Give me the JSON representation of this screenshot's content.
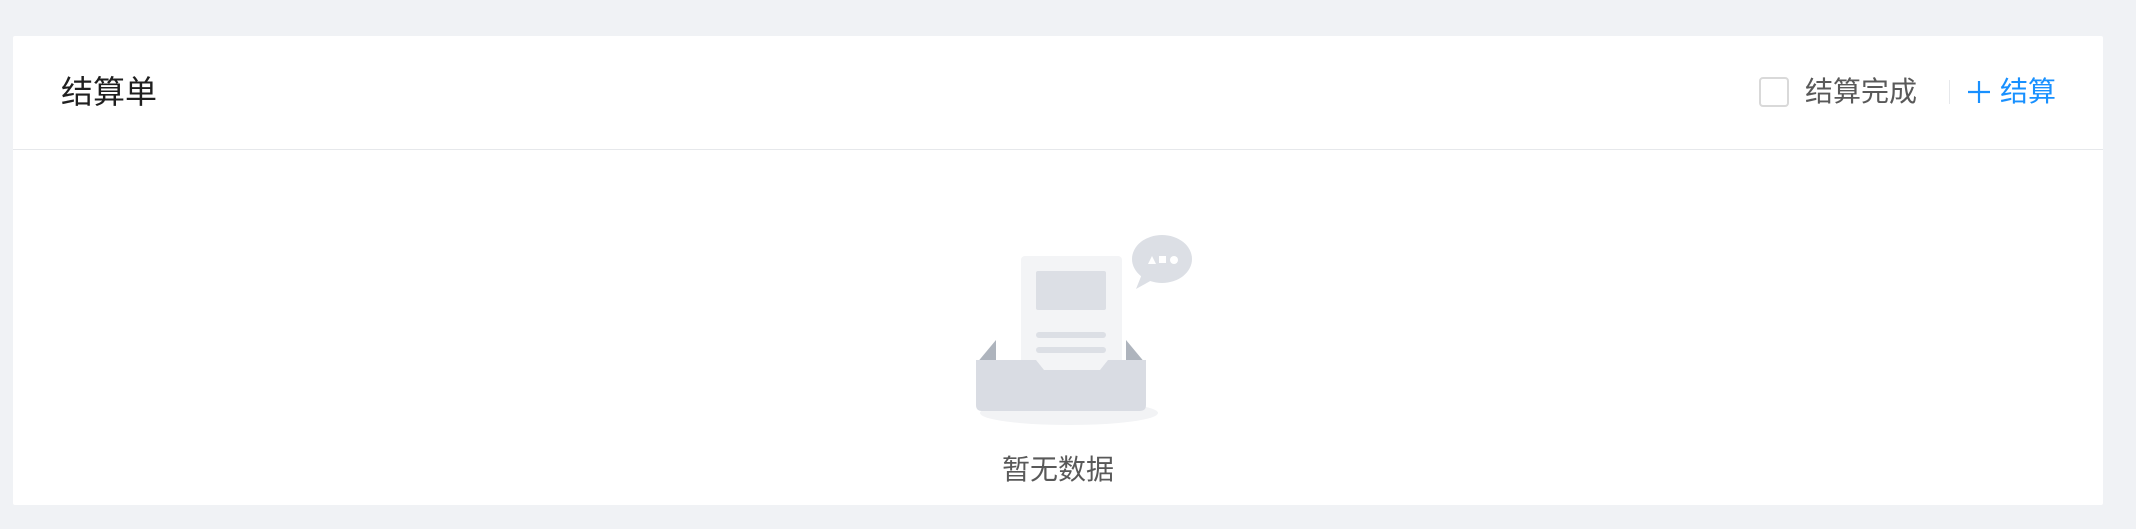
{
  "card": {
    "title": "结算单",
    "actions": {
      "checkbox_label": "结算完成",
      "checkbox_checked": false,
      "add_label": "结算"
    }
  },
  "empty_state": {
    "text": "暂无数据",
    "icon": "empty-inbox-illustration"
  },
  "colors": {
    "background": "#f0f2f5",
    "card": "#ffffff",
    "accent": "#1890ff",
    "text": "#1f1f1f",
    "muted_text": "#595959",
    "border": "#e6e8eb"
  }
}
